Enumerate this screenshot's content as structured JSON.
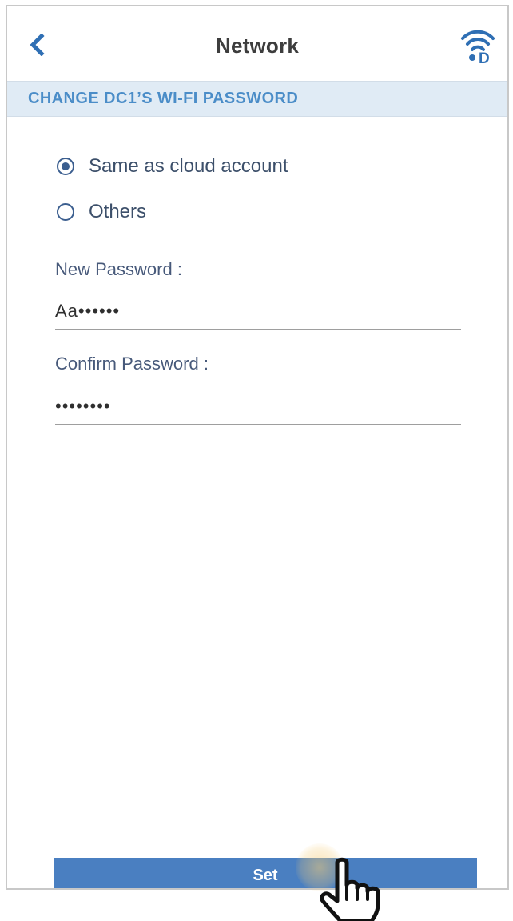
{
  "header": {
    "title": "Network",
    "back_icon": "chevron-left-icon",
    "wifi_icon": "wifi-d-icon"
  },
  "section": {
    "title": "CHANGE DC1’S WI-FI PASSWORD"
  },
  "options": [
    {
      "label": "Same as cloud account",
      "selected": true
    },
    {
      "label": "Others",
      "selected": false
    }
  ],
  "new_password": {
    "label": "New Password :",
    "value": "Aa••••••"
  },
  "confirm_password": {
    "label": "Confirm Password :",
    "value": "••••••••"
  },
  "actions": {
    "set_label": "Set"
  },
  "colors": {
    "accent": "#4a7fc1",
    "banner_bg": "#e0ebf5",
    "banner_text": "#4b8dc8",
    "radio": "#3b5e8f",
    "back_arrow": "#2f6fb4"
  }
}
